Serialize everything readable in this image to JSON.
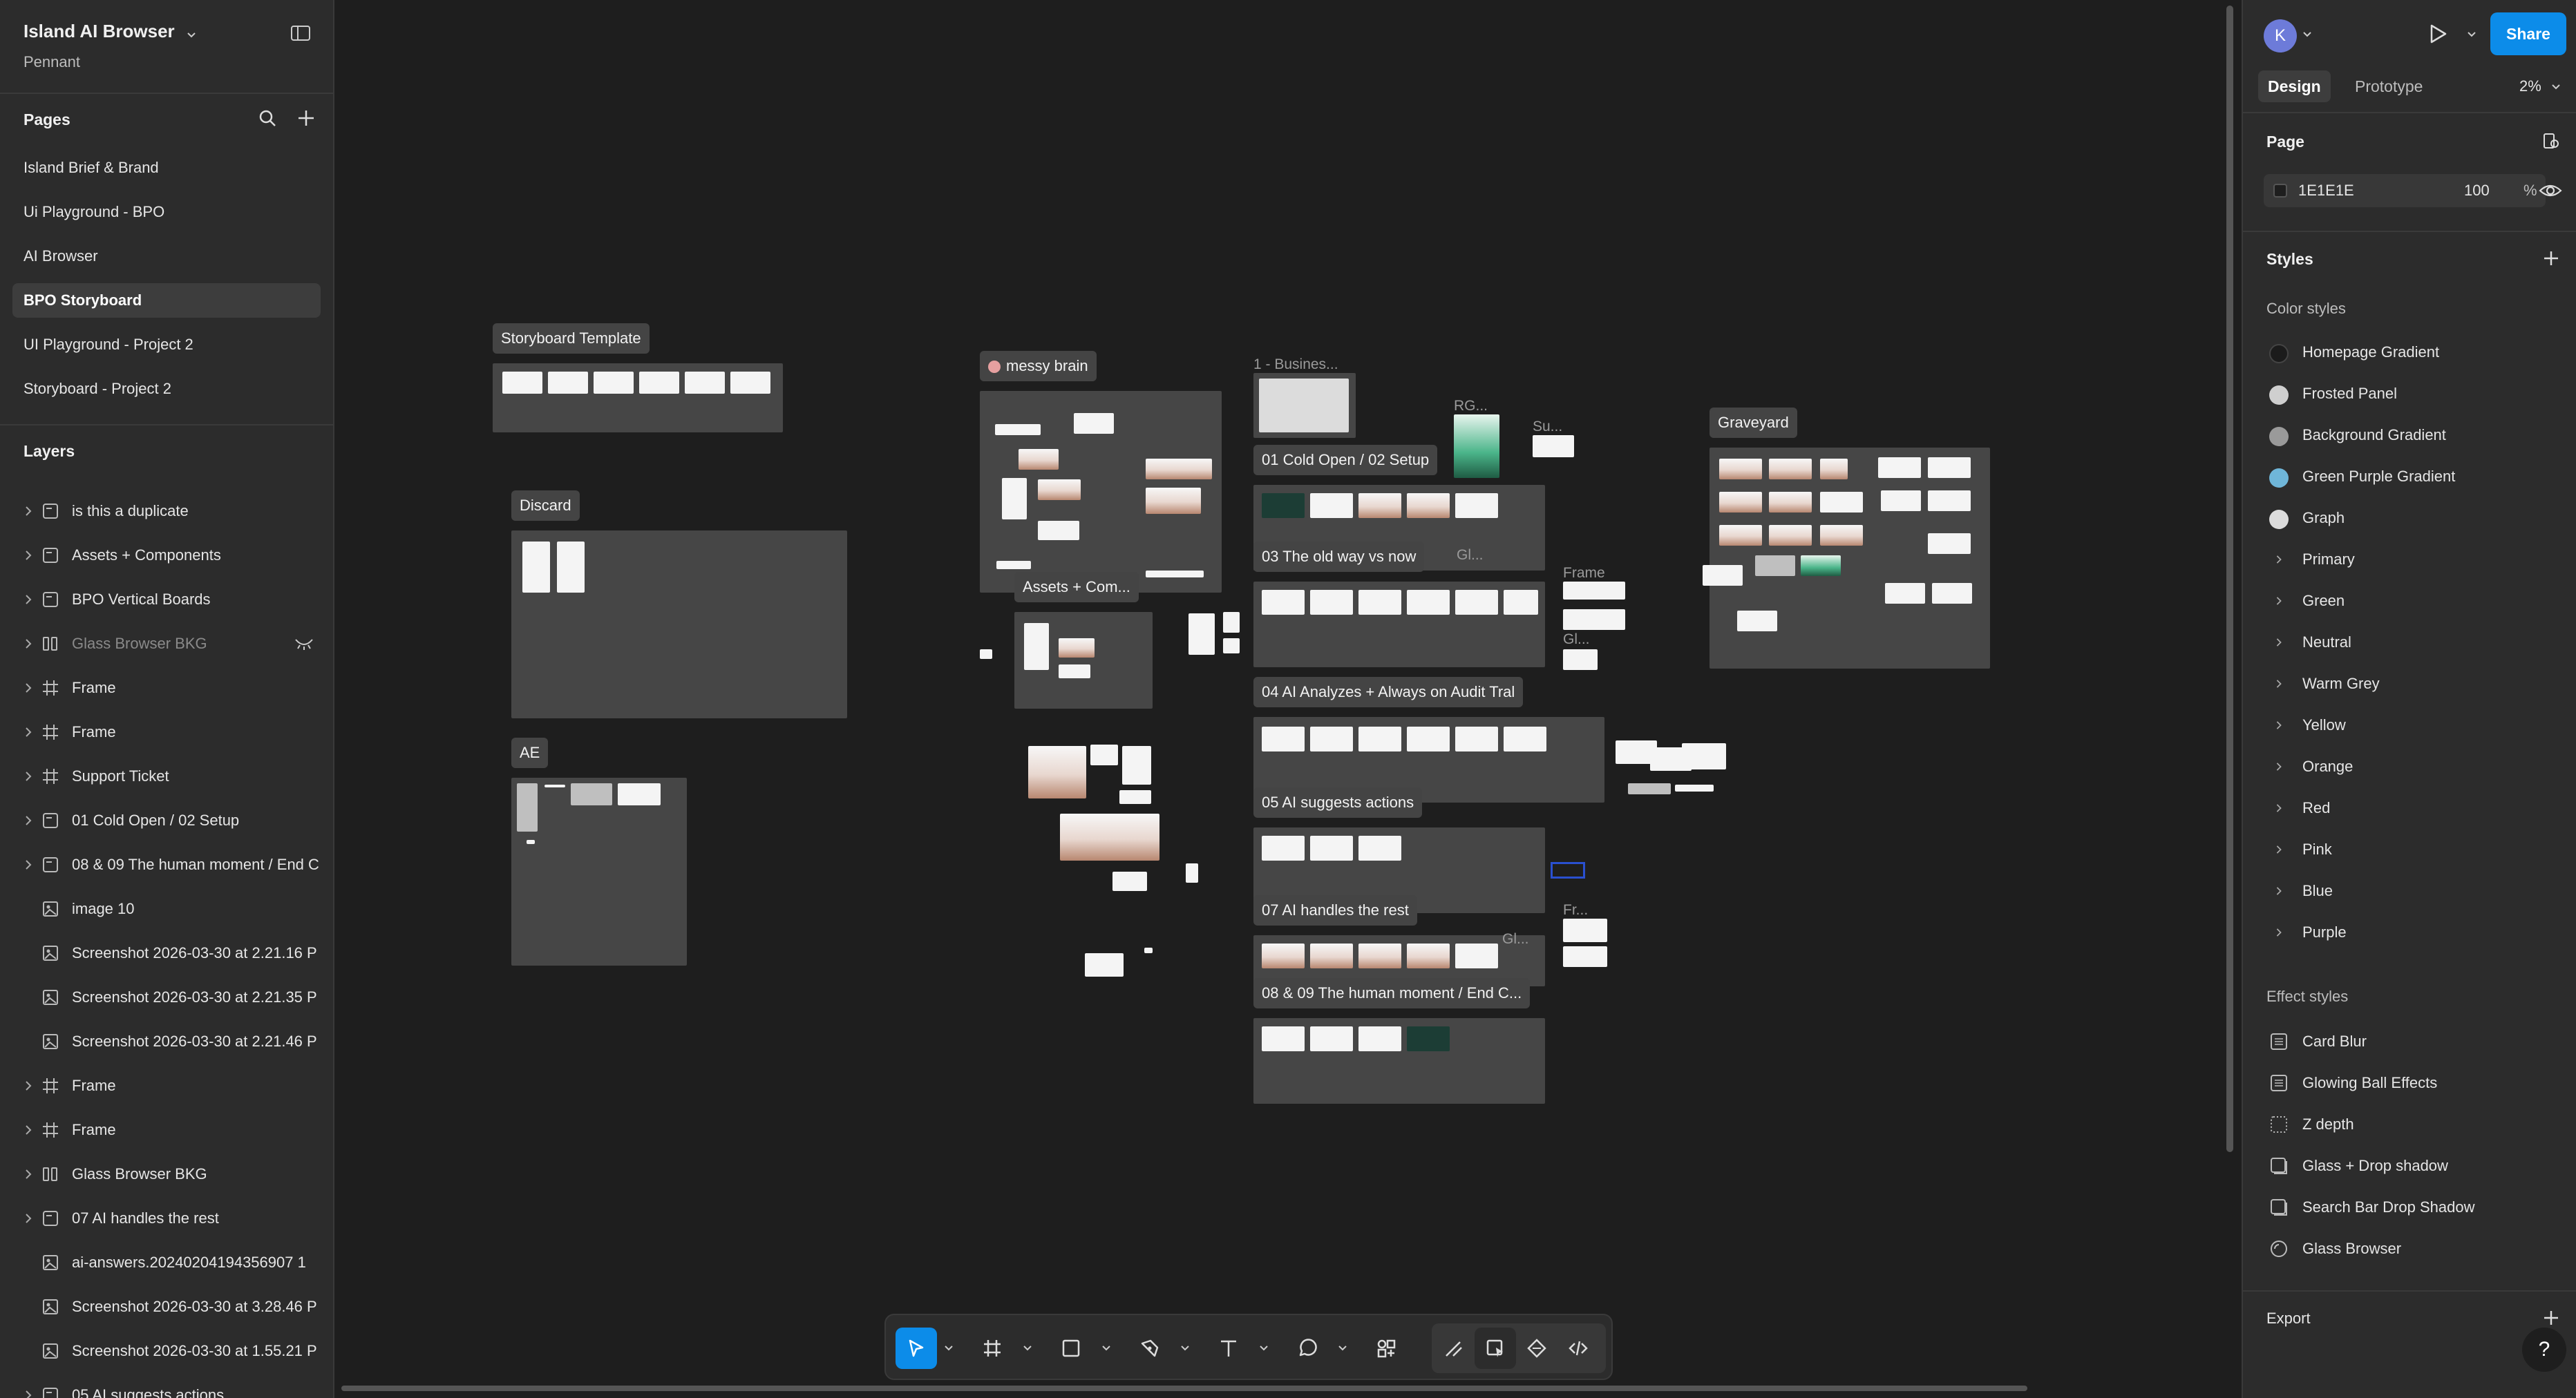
{
  "file": {
    "title": "Island AI Browser",
    "team": "Pennant"
  },
  "pages": {
    "heading": "Pages",
    "items": [
      {
        "label": "Island Brief & Brand"
      },
      {
        "label": "Ui Playground - BPO"
      },
      {
        "label": "AI Browser"
      },
      {
        "label": "BPO Storyboard",
        "active": true
      },
      {
        "label": "UI Playground - Project 2"
      },
      {
        "label": "Storyboard - Project 2"
      }
    ]
  },
  "layers": {
    "heading": "Layers",
    "items": [
      {
        "label": "is this a duplicate",
        "icon": "section-icon"
      },
      {
        "label": "Assets + Components",
        "icon": "section-icon"
      },
      {
        "label": "BPO Vertical Boards",
        "icon": "section-icon"
      },
      {
        "label": "Glass Browser BKG",
        "icon": "auto-layout-icon",
        "hidden": true
      },
      {
        "label": "Frame",
        "icon": "frame-icon"
      },
      {
        "label": "Frame",
        "icon": "frame-icon"
      },
      {
        "label": "Support Ticket",
        "icon": "frame-icon"
      },
      {
        "label": "01 Cold Open / 02 Setup",
        "icon": "section-icon"
      },
      {
        "label": "08 & 09 The human moment / End C",
        "icon": "section-icon"
      },
      {
        "label": "image 10",
        "icon": "image-icon"
      },
      {
        "label": "Screenshot 2026-03-30 at 2.21.16 P",
        "icon": "image-icon"
      },
      {
        "label": "Screenshot 2026-03-30 at 2.21.35 P",
        "icon": "image-icon"
      },
      {
        "label": "Screenshot 2026-03-30 at 2.21.46 P",
        "icon": "image-icon"
      },
      {
        "label": "Frame",
        "icon": "frame-icon"
      },
      {
        "label": "Frame",
        "icon": "frame-icon"
      },
      {
        "label": "Glass Browser BKG",
        "icon": "auto-layout-icon"
      },
      {
        "label": "07 AI handles the rest",
        "icon": "section-icon"
      },
      {
        "label": "ai-answers.20240204194356907 1",
        "icon": "image-icon"
      },
      {
        "label": "Screenshot 2026-03-30 at 3.28.46 P",
        "icon": "image-icon"
      },
      {
        "label": "Screenshot 2026-03-30 at 1.55.21 P",
        "icon": "image-icon"
      },
      {
        "label": "05 AI suggests actions",
        "icon": "section-icon"
      }
    ]
  },
  "canvas": {
    "labels": {
      "storyboard_template": "Storyboard Template",
      "discard": "Discard",
      "ae": "AE",
      "messy_brain": "messy brain",
      "assets_com": "Assets + Com...",
      "business": "1 - Busines...",
      "rg": "RG...",
      "su": "Su...",
      "cold_open": "01 Cold Open / 02 Setup",
      "old_way": "03 The old way vs now",
      "gl1": "Gl...",
      "frame1": "Frame",
      "gl2": "Gl...",
      "ai_analyzes": "04 AI Analyzes + Always on Audit Tral",
      "ai_suggests": "05 AI suggests actions",
      "ai_handles": "07 AI handles the rest",
      "fr": "Fr...",
      "gl3": "Gl...",
      "human_moment": "08 & 09 The human moment / End C...",
      "graveyard": "Graveyard"
    }
  },
  "toolbar": {
    "tools": [
      "move-tool",
      "frame-tool",
      "shape-tool",
      "pen-tool",
      "text-tool",
      "comment-tool",
      "actions-tool"
    ],
    "dev_tools": [
      "draw-mode",
      "design-mode",
      "components-mode",
      "dev-mode"
    ]
  },
  "right_panel": {
    "avatar_initial": "K",
    "share_label": "Share",
    "tabs": {
      "design": "Design",
      "prototype": "Prototype"
    },
    "zoom": "2%",
    "page": {
      "heading": "Page",
      "bg_hex": "1E1E1E",
      "bg_opacity": "100",
      "pct": "%"
    },
    "styles": {
      "heading": "Styles",
      "color_heading": "Color styles",
      "color_swatches": [
        {
          "label": "Homepage Gradient",
          "color": "#1b1b1b"
        },
        {
          "label": "Frosted Panel",
          "color": "#cfcfcf"
        },
        {
          "label": "Background Gradient",
          "color": "#9a9a9a"
        },
        {
          "label": "Green Purple Gradient",
          "color": "#6fb6d9"
        },
        {
          "label": "Graph",
          "color": "#dcdcdc"
        }
      ],
      "color_groups": [
        {
          "label": "Primary"
        },
        {
          "label": "Green"
        },
        {
          "label": "Neutral"
        },
        {
          "label": "Warm Grey"
        },
        {
          "label": "Yellow"
        },
        {
          "label": "Orange"
        },
        {
          "label": "Red"
        },
        {
          "label": "Pink"
        },
        {
          "label": "Blue"
        },
        {
          "label": "Purple"
        }
      ],
      "effect_heading": "Effect styles",
      "effects": [
        {
          "label": "Card Blur",
          "icon": "blur-icon"
        },
        {
          "label": "Glowing Ball Effects",
          "icon": "blur-icon"
        },
        {
          "label": "Z depth",
          "icon": "dotted-square-icon"
        },
        {
          "label": "Glass + Drop shadow",
          "icon": "shadow-icon"
        },
        {
          "label": "Search Bar Drop Shadow",
          "icon": "shadow-icon"
        },
        {
          "label": "Glass Browser",
          "icon": "glass-icon"
        }
      ]
    },
    "export_heading": "Export",
    "help": "?"
  },
  "colors": {
    "accent": "#0c8ce9",
    "panel": "#2c2c2c",
    "canvas": "#1e1e1e"
  }
}
